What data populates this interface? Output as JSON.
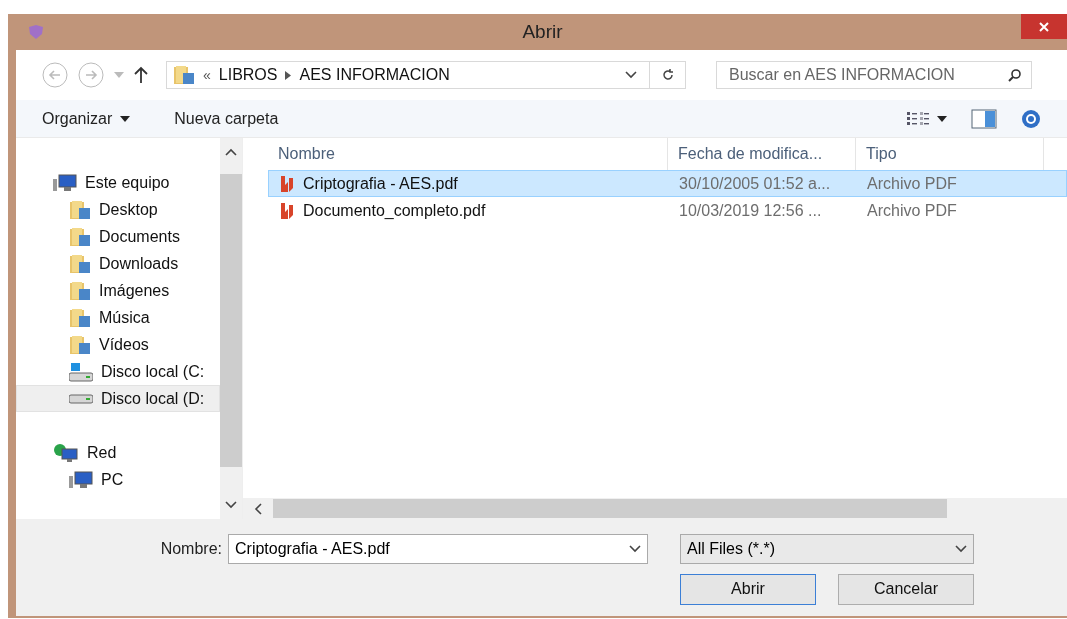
{
  "window": {
    "title": "Abrir"
  },
  "address": {
    "overflow": "«",
    "crumbs": [
      "LIBROS",
      "AES INFORMACION"
    ]
  },
  "search": {
    "placeholder": "Buscar en AES INFORMACION"
  },
  "toolbar": {
    "organize": "Organizar",
    "new_folder": "Nueva carpeta"
  },
  "sidebar": {
    "items": [
      {
        "label": "Este equipo",
        "kind": "computer",
        "selected": false,
        "children": [
          {
            "label": "Desktop",
            "kind": "folder",
            "selected": false
          },
          {
            "label": "Documents",
            "kind": "folder",
            "selected": false
          },
          {
            "label": "Downloads",
            "kind": "folder",
            "selected": false
          },
          {
            "label": "Imágenes",
            "kind": "folder",
            "selected": false
          },
          {
            "label": "Música",
            "kind": "folder",
            "selected": false
          },
          {
            "label": "Vídeos",
            "kind": "folder",
            "selected": false
          },
          {
            "label": "Disco local (C:",
            "kind": "system-drive",
            "selected": false
          },
          {
            "label": "Disco local (D:",
            "kind": "drive",
            "selected": true
          }
        ]
      },
      {
        "label": "Red",
        "kind": "network",
        "selected": false,
        "children": [
          {
            "label": "PC",
            "kind": "computer",
            "selected": false
          }
        ]
      }
    ]
  },
  "table": {
    "columns": [
      "Nombre",
      "Fecha de modifica...",
      "Tipo"
    ],
    "rows": [
      {
        "name": "Criptografia - AES.pdf",
        "date": "30/10/2005 01:52 a...",
        "type": "Archivo PDF",
        "selected": true
      },
      {
        "name": "Documento_completo.pdf",
        "date": "10/03/2019 12:56 ...",
        "type": "Archivo PDF",
        "selected": false
      }
    ]
  },
  "footer": {
    "name_label": "Nombre:",
    "name_value": "Criptografia - AES.pdf",
    "filter": "All Files (*.*)",
    "buttons": [
      "Abrir",
      "Cancelar"
    ]
  }
}
